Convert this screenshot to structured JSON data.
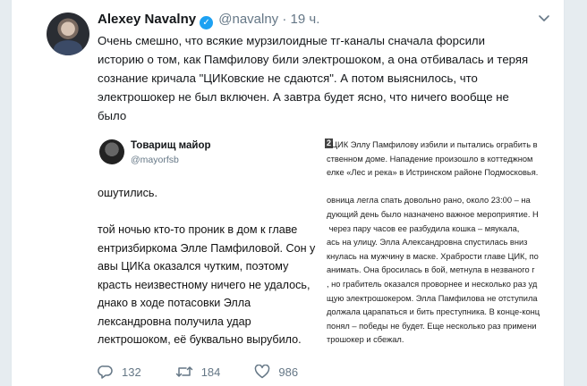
{
  "tweet": {
    "author_name": "Alexey Navalny",
    "handle": "@navalny",
    "separator": "·",
    "time": "19 ч.",
    "verified_glyph": "✓",
    "text": "Очень смешно, что всякие мурзилоидные тг-каналы сначала форсили\nисторию о том, как Памфилову били электрошоком, а она отбивалась и теряя\nсознание кричала \"ЦИКовские не сдаются\". А потом выяснилось, что\nэлектрошокер не был включен. А завтра будет ясно, что ничего вообще не\nбыло"
  },
  "media": {
    "left": {
      "name": "Товарищ майор",
      "handle": "@mayorfsb",
      "body": "ошутились.\n\nтой ночью кто-то проник в дом к главе\nентризбиркома Элле Памфиловой. Сон у\nавы ЦИКа оказался чутким, поэтому\nкрасть неизвестному ничего не удалось,\nднако в ходе потасовки Элла\nлександровна получила удар\nлектрошоком, её буквально вырубило."
    },
    "right": {
      "number": "2",
      "body": "  ЦИК Эллу Памфилову избили и пытались ограбить в\nственном доме. Нападение произошло в коттеджном\nелке «Лес и река» в Истринском районе Подмосковья.\n\nовница легла спать довольно рано, около 23:00 – на\nдующий день было назначено важное мероприятие. Н\n через пару часов ее разбудила кошка – мяукала,\nась на улицу. Элла Александровна спустилась вниз\nкнулась на мужчину в маске. Храбрости главе ЦИК, по\nанимать. Она бросилась в бой, метнула в незваного г\n, но грабитель оказался проворнее и несколько раз уд\nщую электрошокером. Элла Памфилова не отступила\nдолжала царапаться и бить преступника. В конце-конц\nпонял – победы не будет. Еще несколько раз примени\nтрошокер и сбежал.\n\nле инцидента, Элла Памфилова позвонила в полицию\n. Сама выпила успокоительное и легла спать. Сейч"
    }
  },
  "actions": {
    "replies": "132",
    "retweets": "184",
    "likes": "986"
  },
  "colors": {
    "verified": "#1da1f2",
    "muted": "#657786"
  },
  "icons": [
    "reply-icon",
    "retweet-icon",
    "like-icon",
    "chevron-down-icon",
    "verified-icon"
  ]
}
